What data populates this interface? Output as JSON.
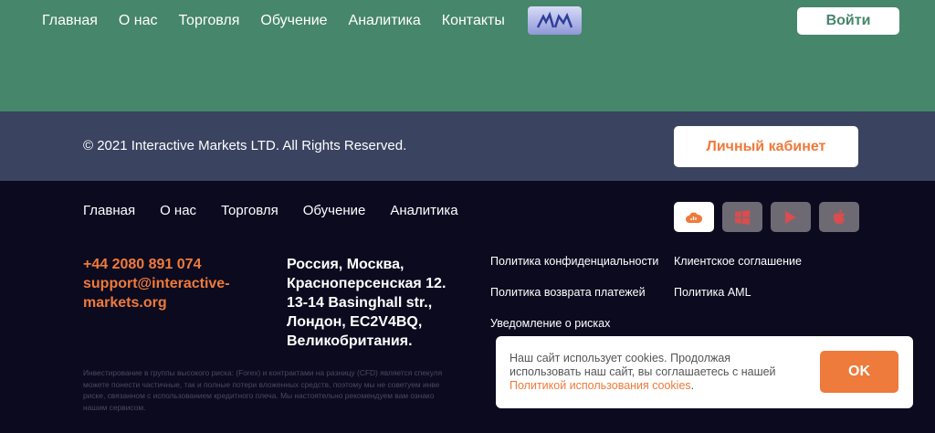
{
  "header": {
    "nav": [
      "Главная",
      "О нас",
      "Торговля",
      "Обучение",
      "Аналитика",
      "Контакты"
    ],
    "login_label": "Войти",
    "logo_icon": "im-logo-icon"
  },
  "strip": {
    "copyright": "© 2021 Interactive Markets LTD. All Rights Reserved.",
    "cabinet_label": "Личный кабинет"
  },
  "footer": {
    "nav": [
      "Главная",
      "О нас",
      "Торговля",
      "Обучение",
      "Аналитика"
    ],
    "apps": [
      "webtrader-icon",
      "windows-icon",
      "google-play-icon",
      "apple-icon"
    ],
    "phone": "+44 2080 891 074",
    "email_line1": "support@interactive-",
    "email_line2": "markets.org",
    "address": [
      "Россия, Москва,",
      "Красноперсенская 12.",
      "13-14 Basinghall str.,",
      "Лондон, EC2V4BQ,",
      "Великобритания."
    ],
    "links": [
      "Политика конфиденциальности",
      "Клиентское соглашение",
      "Политика возврата платежей",
      "Политика AML",
      "Уведомление о рисках"
    ],
    "disclaimer": [
      "Инвестирование в группы высокого риска: (Forex) и контрактами на разницу (CFD) является спекуля",
      "можете понести частичные, так и полные потери вложенных средств, поэтому мы не советуем инве",
      "риске, связанном с использованием кредитного плеча. Мы настоятельно рекомендуем вам ознако",
      "нашим сервисом."
    ]
  },
  "cookie": {
    "text_line1": "Наш сайт использует cookies. Продолжая",
    "text_line2": "использовать наш сайт, вы соглашаетесь с нашей",
    "link": "Политикой использования cookies",
    "suffix": ".",
    "ok_label": "OK"
  },
  "colors": {
    "header_green": "#46866a",
    "strip": "#3a4360",
    "footer": "#0c0a1f",
    "accent": "#ee7a3b"
  }
}
